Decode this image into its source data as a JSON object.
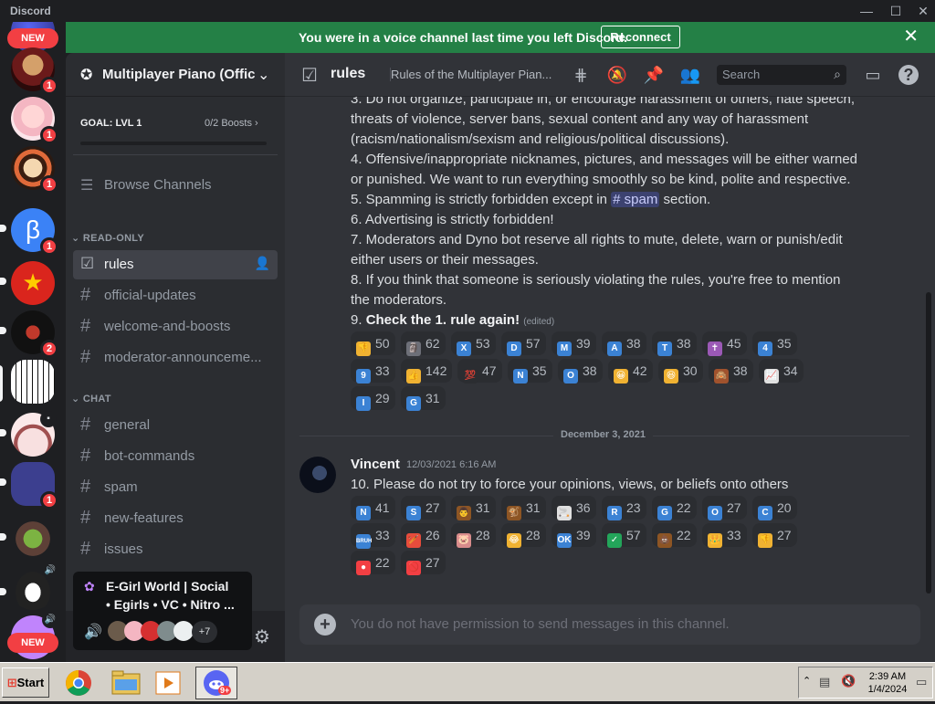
{
  "titlebar": {
    "title": "Discord",
    "minimize": "—",
    "maximize": "☐",
    "close": "✕"
  },
  "banner": {
    "message": "You were in a voice channel last time you left Discord.",
    "button": "Reconnect",
    "close": "✕"
  },
  "rail": {
    "new_top": "NEW",
    "new_bottom": "NEW",
    "servers": [
      {
        "badge": "1"
      },
      {
        "badge": "1"
      },
      {
        "badge": "1"
      },
      {
        "badge": "1"
      },
      {
        "badge": ""
      },
      {
        "badge": "2"
      },
      {
        "badge": ""
      },
      {
        "badge": ""
      },
      {
        "badge": "1"
      },
      {
        "badge": ""
      },
      {
        "badge": ""
      },
      {
        "badge": ""
      }
    ]
  },
  "server": {
    "name": "Multiplayer Piano (Offic",
    "goal": "GOAL: LVL 1",
    "boosts": "0/2 Boosts",
    "browse": "Browse Channels"
  },
  "categories": {
    "readonly": "READ-ONLY",
    "chat": "CHAT"
  },
  "channels_readonly": [
    "rules",
    "official-updates",
    "welcome-and-boosts",
    "moderator-announceme..."
  ],
  "channels_chat": [
    "general",
    "bot-commands",
    "spam",
    "new-features",
    "issues"
  ],
  "voice_popup": {
    "line1": "E-Girl World | Social",
    "line2": "• Egirls • VC • Nitro ...",
    "more": "+7"
  },
  "chat_header": {
    "name": "rules",
    "topic": "Rules of the Multiplayer Pian...",
    "search_placeholder": "Search"
  },
  "rules_text": {
    "l1": "3. Do not organize, participate in, or encourage harassment of others, hate speech,",
    "l2": "threats of violence, server bans, sexual content and any way of harassment",
    "l3": "(racism/nationalism/sexism and religious/political discussions).",
    "l4": "4. Offensive/inappropriate nicknames, pictures, and messages will be either warned",
    "l5": "or punished. We want to run everything smoothly so be kind, polite and respective.",
    "l6a": "5. Spamming is strictly forbidden except in",
    "l6m": "# spam",
    "l6b": "section.",
    "l7": "6. Advertising is strictly forbidden!",
    "l8": "7. Moderators and Dyno bot reserve all rights to mute, delete, warn or punish/edit",
    "l9": "either users or their messages.",
    "l10": "8. If you think that someone is seriously violating the rules, you're free to mention",
    "l11": "the moderators.",
    "l12a": "9.",
    "l12b": "Check the 1. rule again!",
    "l12c": "(edited)"
  },
  "reactions1": [
    {
      "emoji": "👎",
      "count": "50",
      "color": "#f0b232"
    },
    {
      "emoji": "🗿",
      "count": "62",
      "color": "#6d6f78"
    },
    {
      "emoji": "X",
      "count": "53",
      "color": "#3b82d4"
    },
    {
      "emoji": "D",
      "count": "57",
      "color": "#3b82d4"
    },
    {
      "emoji": "M",
      "count": "39",
      "color": "#3b82d4"
    },
    {
      "emoji": "A",
      "count": "38",
      "color": "#3b82d4"
    },
    {
      "emoji": "T",
      "count": "38",
      "color": "#3b82d4"
    },
    {
      "emoji": "✝",
      "count": "45",
      "color": "#9b59b6"
    },
    {
      "emoji": "4",
      "count": "35",
      "color": "#3b82d4"
    },
    {
      "emoji": "9",
      "count": "33",
      "color": "#3b82d4"
    },
    {
      "emoji": "👍",
      "count": "142",
      "color": "#f0b232"
    },
    {
      "emoji": "💯",
      "count": "47",
      "color": "#2b2d31"
    },
    {
      "emoji": "N",
      "count": "35",
      "color": "#3b82d4"
    },
    {
      "emoji": "O",
      "count": "38",
      "color": "#3b82d4"
    },
    {
      "emoji": "😀",
      "count": "42",
      "color": "#f0b232"
    },
    {
      "emoji": "😆",
      "count": "30",
      "color": "#f0b232"
    },
    {
      "emoji": "🙈",
      "count": "38",
      "color": "#a0522d"
    },
    {
      "emoji": "📈",
      "count": "34",
      "color": "#e0e0e0"
    },
    {
      "emoji": "I",
      "count": "29",
      "color": "#3b82d4"
    },
    {
      "emoji": "G",
      "count": "31",
      "color": "#3b82d4"
    }
  ],
  "divider": "December 3, 2021",
  "message2": {
    "author": "Vincent",
    "time": "12/03/2021 6:16 AM",
    "text": "10. Please do not try to force your opinions, views, or beliefs onto others"
  },
  "reactions2": [
    {
      "emoji": "N",
      "count": "41",
      "color": "#3b82d4"
    },
    {
      "emoji": "S",
      "count": "27",
      "color": "#3b82d4"
    },
    {
      "emoji": "👨",
      "count": "31",
      "color": "#8d5524"
    },
    {
      "emoji": "🐒",
      "count": "31",
      "color": "#8d5524"
    },
    {
      "emoji": "🚬",
      "count": "36",
      "color": "#e0e0e0"
    },
    {
      "emoji": "R",
      "count": "23",
      "color": "#3b82d4"
    },
    {
      "emoji": "G",
      "count": "22",
      "color": "#3b82d4"
    },
    {
      "emoji": "O",
      "count": "27",
      "color": "#3b82d4"
    },
    {
      "emoji": "C",
      "count": "20",
      "color": "#3b82d4"
    },
    {
      "emoji": "BRUH",
      "count": "33",
      "color": "#3b82d4"
    },
    {
      "emoji": "🏏",
      "count": "26",
      "color": "#e74c3c"
    },
    {
      "emoji": "🐷",
      "count": "28",
      "color": "#d98c8c"
    },
    {
      "emoji": "😂",
      "count": "28",
      "color": "#f0b232"
    },
    {
      "emoji": "OK",
      "count": "39",
      "color": "#3b82d4"
    },
    {
      "emoji": "✓",
      "count": "57",
      "color": "#23a55a"
    },
    {
      "emoji": "💩",
      "count": "22",
      "color": "#8d5524"
    },
    {
      "emoji": "👑",
      "count": "33",
      "color": "#f0b232"
    },
    {
      "emoji": "👎",
      "count": "27",
      "color": "#f0b232"
    },
    {
      "emoji": "●",
      "count": "22",
      "color": "#f23f43"
    },
    {
      "emoji": "🚫",
      "count": "27",
      "color": "#f23f43"
    }
  ],
  "composer": {
    "placeholder": "You do not have permission to send messages in this channel."
  },
  "taskbar": {
    "start": "Start",
    "time": "2:39 AM",
    "date": "1/4/2024",
    "discord_badge": "9+"
  }
}
